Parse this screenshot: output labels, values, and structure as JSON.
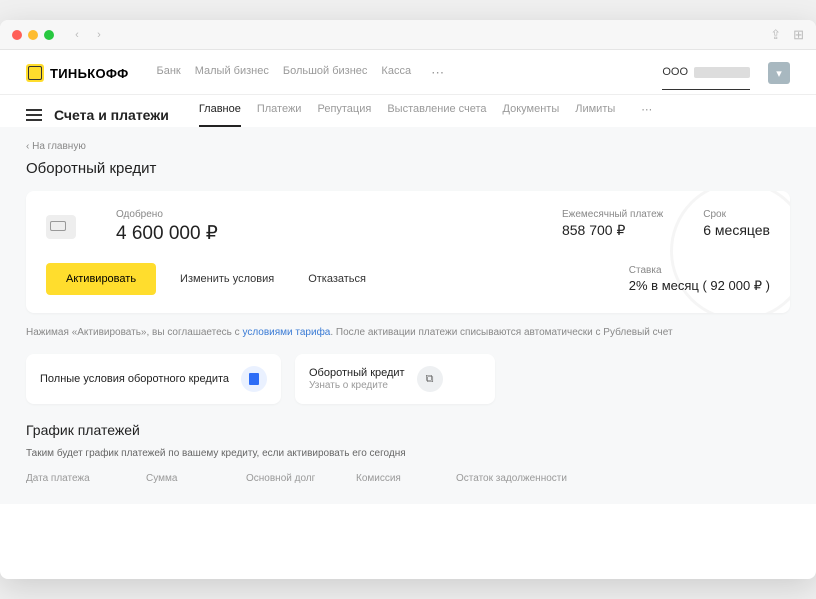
{
  "brand": "ТИНЬКОФФ",
  "topnav": [
    "Банк",
    "Малый бизнес",
    "Большой бизнес",
    "Касса"
  ],
  "account_prefix": "ООО",
  "page_title": "Счета и платежи",
  "tabs": [
    "Главное",
    "Платежи",
    "Репутация",
    "Выставление счета",
    "Документы",
    "Лимиты"
  ],
  "back": "‹ На главную",
  "h1": "Оборотный кредит",
  "approved": {
    "label": "Одобрено",
    "value": "4 600 000 ₽"
  },
  "monthly": {
    "label": "Ежемесячный платеж",
    "value": "858 700 ₽"
  },
  "term": {
    "label": "Срок",
    "value": "6 месяцев"
  },
  "btn_activate": "Активировать",
  "btn_change": "Изменить условия",
  "btn_decline": "Отказаться",
  "rate": {
    "label": "Ставка",
    "value": "2% в месяц ( 92 000 ₽ )"
  },
  "disclaimer_pre": "Нажимая «Активировать», вы соглашаетесь с ",
  "disclaimer_link": "условиями тарифа",
  "disclaimer_post": ". После активации платежи списываются автоматически с Рублевый счет",
  "card1": {
    "title": "Полные условия оборотного кредита"
  },
  "card2": {
    "title": "Оборотный кредит",
    "sub": "Узнать о кредите"
  },
  "h2": "График платежей",
  "schedule_sub": "Таким будет график платежей по вашему кредиту, если активировать его сегодня",
  "cols": [
    "Дата платежа",
    "Сумма",
    "Основной долг",
    "Комиссия",
    "Остаток задолженности"
  ]
}
